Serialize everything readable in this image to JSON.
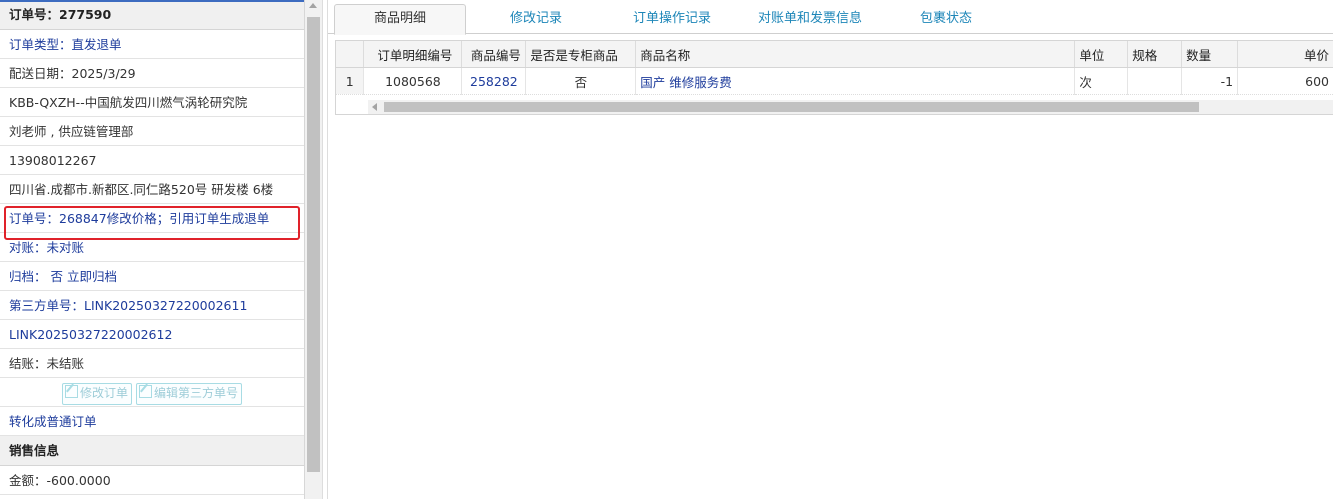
{
  "order": {
    "title": "订单号：277590",
    "type": "订单类型：直发退单",
    "delivery_date": "配送日期：2025/3/29",
    "customer": "KBB-QXZH--中国航发四川燃气涡轮研究院",
    "contact": "刘老师 , 供应链管理部",
    "phone": "13908012267",
    "address": "四川省.成都市.新都区.同仁路520号 研发楼 6楼",
    "remark": "订单号：268847修改价格；引用订单生成退单",
    "reconcile": "对账：未对账",
    "archive_label": "归档：",
    "archive_value": "否",
    "archive_link": "立即归档",
    "third_party_1": "第三方单号：LINK20250327220002611",
    "third_party_2": "LINK20250327220002612",
    "settlement": "结账：未结账",
    "edit_order_btn": "修改订单",
    "edit_third_btn": "编辑第三方单号",
    "convert_link": "转化成普通订单"
  },
  "sales": {
    "header": "销售信息",
    "amount": "金额：-600.0000"
  },
  "tabs": [
    {
      "label": "商品明细",
      "active": true
    },
    {
      "label": "修改记录",
      "active": false
    },
    {
      "label": "订单操作记录",
      "active": false
    },
    {
      "label": "对账单和发票信息",
      "active": false
    },
    {
      "label": "包裹状态",
      "active": false
    }
  ],
  "table": {
    "columns": [
      "订单明细编号",
      "商品编号",
      "是否是专柜商品",
      "商品名称",
      "单位",
      "规格",
      "数量",
      "单价"
    ],
    "rows": [
      {
        "index": "1",
        "detail_id": "1080568",
        "product_id": "258282",
        "is_counter": "否",
        "name": "国产 维修服务费",
        "unit": "次",
        "spec": "",
        "qty": "-1",
        "price": "600"
      }
    ]
  },
  "colors": {
    "link": "#1e3c9c",
    "tab_link": "#1d86b8",
    "highlight": "#e0222a"
  }
}
